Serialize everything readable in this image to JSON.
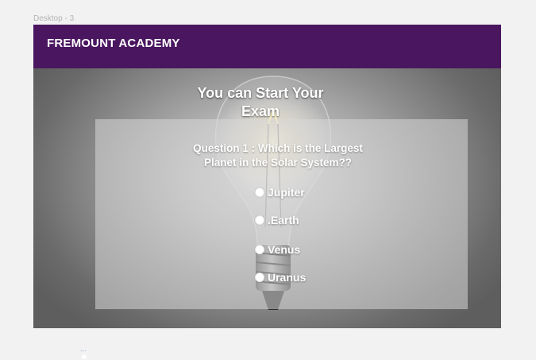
{
  "canvas": {
    "frame_label": "Desktop - 3"
  },
  "header": {
    "brand": "FREMOUNT ACADEMY",
    "background_color": "#4a1660"
  },
  "hero": {
    "title_line1": "You can Start Your",
    "title_line2": "Exam",
    "background_image": "light-bulb-photo"
  },
  "question": {
    "line1": "Question 1 : Which is the Largest",
    "line2": "Planet in the Solar System??",
    "options": [
      {
        "label": "Jupiter"
      },
      {
        "label": ".Earth"
      },
      {
        "label": "Venus"
      },
      {
        "label": "Uranus"
      }
    ]
  },
  "footer": {
    "dots": "..."
  }
}
